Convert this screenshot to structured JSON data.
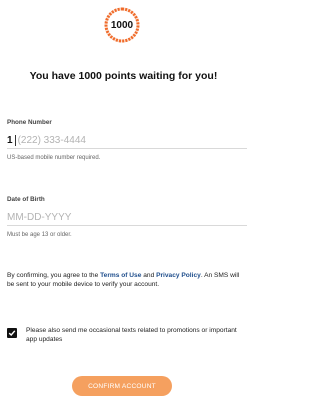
{
  "points_badge": {
    "value": "1000",
    "progress": 1.0,
    "accent_color": "#f06a2a"
  },
  "headline": "You have 1000 points waiting for you!",
  "phone": {
    "label": "Phone Number",
    "country_code": "1",
    "placeholder": "(222) 333-4444",
    "hint": "US-based mobile number required."
  },
  "dob": {
    "label": "Date of Birth",
    "placeholder": "MM-DD-YYYY",
    "hint": "Must be age 13 or older."
  },
  "consent": {
    "text_1": "By confirming, you agree to the ",
    "terms_link": "Terms of Use",
    "text_2": " and ",
    "privacy_link": "Privacy Policy",
    "text_3": ". An SMS will be sent to your mobile device to verify your account.",
    "link_color": "#1f4e8c"
  },
  "optin": {
    "checked": true,
    "icon": "checkmark-icon",
    "label": "Please also send me occasional texts related to promotions or important app updates"
  },
  "confirm_button": {
    "label": "CONFIRM ACCOUNT",
    "color": "#f5a05f"
  }
}
